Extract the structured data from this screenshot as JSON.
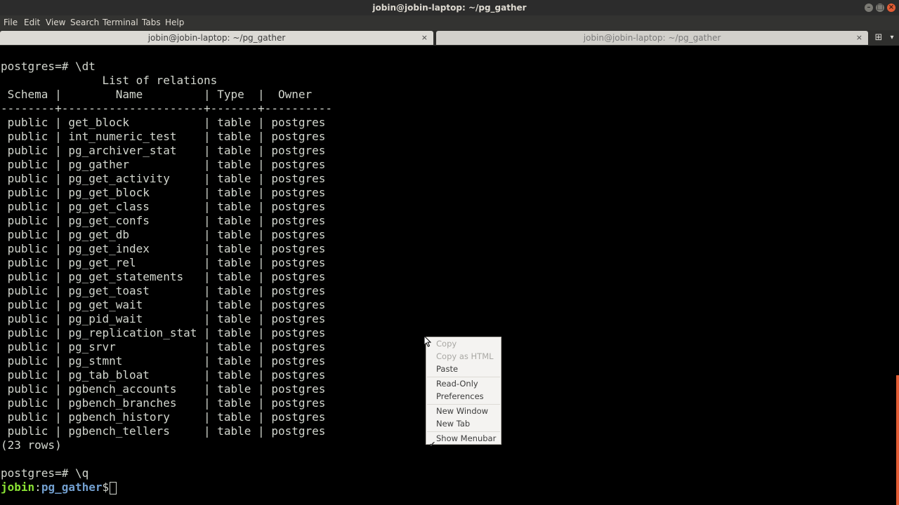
{
  "window": {
    "title": "jobin@jobin-laptop: ~/pg_gather",
    "buttons": {
      "minimize": "–",
      "maximize": "□",
      "close": "×"
    }
  },
  "menubar": [
    "File",
    "Edit",
    "View",
    "Search",
    "Terminal",
    "Tabs",
    "Help"
  ],
  "tabs": [
    {
      "label": "jobin@jobin-laptop: ~/pg_gather",
      "active": true,
      "close": "×"
    },
    {
      "label": "jobin@jobin-laptop: ~/pg_gather",
      "active": false,
      "close": "×"
    }
  ],
  "tabbar_icons": {
    "new_tab": "⊞",
    "arrow": "▾"
  },
  "terminal": {
    "command_line": "postgres=# \\dt",
    "table_title": "               List of relations",
    "header": " Schema |        Name         | Type  |  Owner",
    "separator": "--------+---------------------+-------+----------",
    "rows": [
      " public | get_block           | table | postgres",
      " public | int_numeric_test    | table | postgres",
      " public | pg_archiver_stat    | table | postgres",
      " public | pg_gather           | table | postgres",
      " public | pg_get_activity     | table | postgres",
      " public | pg_get_block        | table | postgres",
      " public | pg_get_class        | table | postgres",
      " public | pg_get_confs        | table | postgres",
      " public | pg_get_db           | table | postgres",
      " public | pg_get_index        | table | postgres",
      " public | pg_get_rel          | table | postgres",
      " public | pg_get_statements   | table | postgres",
      " public | pg_get_toast        | table | postgres",
      " public | pg_get_wait         | table | postgres",
      " public | pg_pid_wait         | table | postgres",
      " public | pg_replication_stat | table | postgres",
      " public | pg_srvr             | table | postgres",
      " public | pg_stmnt            | table | postgres",
      " public | pg_tab_bloat        | table | postgres",
      " public | pgbench_accounts    | table | postgres",
      " public | pgbench_branches    | table | postgres",
      " public | pgbench_history     | table | postgres",
      " public | pgbench_tellers     | table | postgres"
    ],
    "row_count": "(23 rows)",
    "quit_line": "postgres=# \\q",
    "prompt": {
      "user": "jobin",
      "colon": ":",
      "path": "pg_gather",
      "dollar": "$"
    }
  },
  "context_menu": {
    "items": [
      {
        "label": "Copy",
        "enabled": false
      },
      {
        "label": "Copy as HTML",
        "enabled": false
      },
      {
        "label": "Paste",
        "enabled": true
      },
      {
        "label": "Read-Only",
        "enabled": true
      },
      {
        "label": "Preferences",
        "enabled": true
      },
      {
        "label": "New Window",
        "enabled": true
      },
      {
        "label": "New Tab",
        "enabled": true
      },
      {
        "label": "Show Menubar",
        "enabled": true,
        "checked": true
      }
    ],
    "check_glyph": "✔"
  },
  "colors": {
    "prompt_user": "#8ae234",
    "prompt_path": "#729fcf",
    "scrollbar_accent": "#e45d35"
  }
}
